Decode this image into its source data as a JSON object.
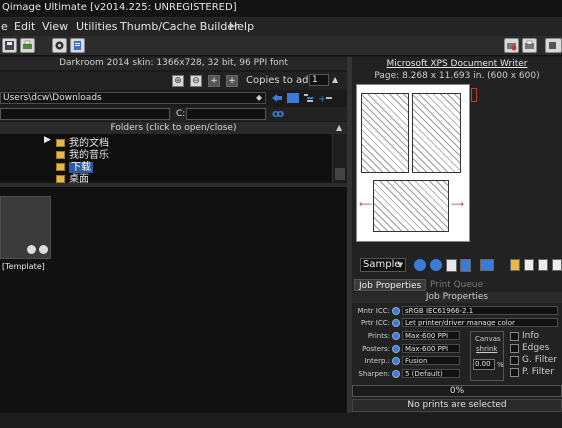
{
  "window": {
    "title": "Qimage Ultimate [v2014.225: UNREGISTERED]"
  },
  "menu": [
    {
      "label": "e"
    },
    {
      "label": "Edit"
    },
    {
      "label": "View"
    },
    {
      "label": "Utilities"
    },
    {
      "label": "Thumb/Cache Builder"
    },
    {
      "label": "Help"
    }
  ],
  "left": {
    "skin_info": "Darkroom 2014 skin: 1366x728, 32 bit, 96 PPI font",
    "copies_label": "Copies to add:",
    "copies_value": "1",
    "path": "Users\\dcw\\Downloads",
    "drive_label": "C:",
    "folders_header": "Folders (click to open/close)",
    "folders": [
      {
        "label": "我的文档",
        "expanded": false
      },
      {
        "label": "我的音乐",
        "expanded": false
      },
      {
        "label": "下载",
        "selected": true
      },
      {
        "label": "桌面",
        "expanded": false
      }
    ],
    "thumbnail_label": "[Template]"
  },
  "right": {
    "printer_name": "Microsoft XPS Document Writer",
    "page_size": "Page: 8.268 x 11.693 in.  (600 x 600)",
    "sample_select": "Sample",
    "tabs": [
      {
        "label": "Job Properties",
        "active": true
      },
      {
        "label": "Print Queue",
        "active": false
      }
    ],
    "job_header": "Job Properties",
    "properties": [
      {
        "label": "Mntr ICC:",
        "value": "sRGB IEC61966-2.1"
      },
      {
        "label": "Prtr ICC:",
        "value": "Let printer/driver manage color"
      },
      {
        "label": "Prints:",
        "value": "Max-600 PPI"
      },
      {
        "label": "Posters:",
        "value": "Max-600 PPI"
      },
      {
        "label": "Interp.:",
        "value": "Fusion"
      },
      {
        "label": "Sharpen:",
        "value": "5 (Default)"
      }
    ],
    "canvas_label": "Canvas",
    "shrink_label": "shrink",
    "shrink_value": "0.00",
    "shrink_unit": "%",
    "checkboxes": [
      {
        "label": "Info"
      },
      {
        "label": "Edges"
      },
      {
        "label": "G. Filter"
      },
      {
        "label": "P. Filter"
      }
    ],
    "progress": "0%",
    "status": "No prints are selected"
  },
  "colors": {
    "accent": "#3b7bd8",
    "folder_icon": "#e6b84a",
    "background": "#1b1b1b"
  }
}
